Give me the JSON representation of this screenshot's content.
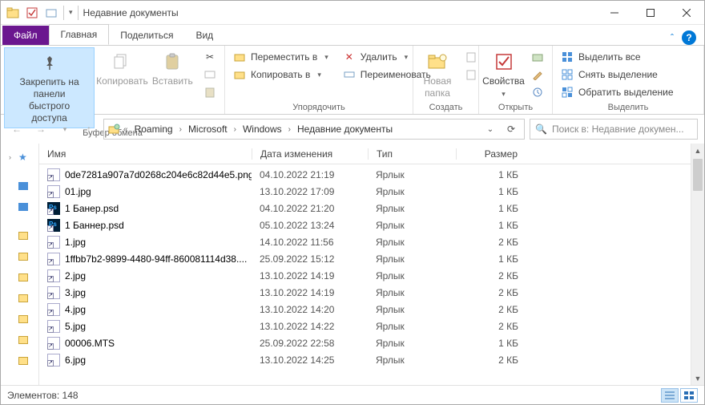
{
  "window": {
    "title": "Недавние документы"
  },
  "tabs": {
    "file": "Файл",
    "home": "Главная",
    "share": "Поделиться",
    "view": "Вид"
  },
  "ribbon": {
    "clipboard": {
      "pin": "Закрепить на панели\nбыстрого доступа",
      "copy": "Копировать",
      "paste": "Вставить",
      "label": "Буфер обмена"
    },
    "organize": {
      "move": "Переместить в",
      "copy_to": "Копировать в",
      "delete": "Удалить",
      "rename": "Переименовать",
      "label": "Упорядочить"
    },
    "new": {
      "folder": "Новая\nпапка",
      "label": "Создать"
    },
    "open": {
      "props": "Свойства",
      "label": "Открыть"
    },
    "select": {
      "all": "Выделить все",
      "none": "Снять выделение",
      "invert": "Обратить выделение",
      "label": "Выделить"
    }
  },
  "breadcrumbs": [
    "Roaming",
    "Microsoft",
    "Windows",
    "Недавние документы"
  ],
  "search_placeholder": "Поиск в: Недавние докумен...",
  "columns": {
    "name": "Имя",
    "date": "Дата изменения",
    "type": "Тип",
    "size": "Размер"
  },
  "type_label": "Ярлык",
  "files": [
    {
      "name": "0de7281a907a7d0268c204e6c82d44e5.png",
      "date": "04.10.2022 21:19",
      "size": "1 КБ",
      "icon": "file"
    },
    {
      "name": "01.jpg",
      "date": "13.10.2022 17:09",
      "size": "1 КБ",
      "icon": "file"
    },
    {
      "name": "1 Банер.psd",
      "date": "04.10.2022 21:20",
      "size": "1 КБ",
      "icon": "ps"
    },
    {
      "name": "1 Баннер.psd",
      "date": "05.10.2022 13:24",
      "size": "1 КБ",
      "icon": "ps"
    },
    {
      "name": "1.jpg",
      "date": "14.10.2022 11:56",
      "size": "2 КБ",
      "icon": "file"
    },
    {
      "name": "1ffbb7b2-9899-4480-94ff-860081114d38....",
      "date": "25.09.2022 15:12",
      "size": "1 КБ",
      "icon": "file"
    },
    {
      "name": "2.jpg",
      "date": "13.10.2022 14:19",
      "size": "2 КБ",
      "icon": "file"
    },
    {
      "name": "3.jpg",
      "date": "13.10.2022 14:19",
      "size": "2 КБ",
      "icon": "file"
    },
    {
      "name": "4.jpg",
      "date": "13.10.2022 14:20",
      "size": "2 КБ",
      "icon": "file"
    },
    {
      "name": "5.jpg",
      "date": "13.10.2022 14:22",
      "size": "2 КБ",
      "icon": "file"
    },
    {
      "name": "00006.MTS",
      "date": "25.09.2022 22:58",
      "size": "1 КБ",
      "icon": "file"
    },
    {
      "name": "6.jpg",
      "date": "13.10.2022 14:25",
      "size": "2 КБ",
      "icon": "file"
    }
  ],
  "status": {
    "items": "Элементов: 148"
  }
}
